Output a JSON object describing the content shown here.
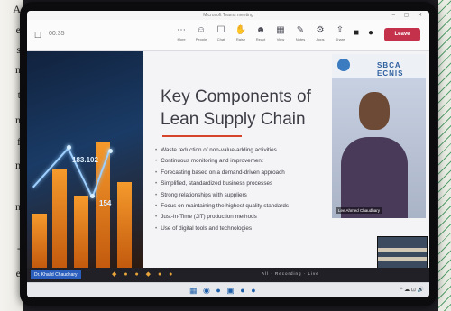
{
  "left_page": {
    "letters": [
      "A",
      "e",
      "s",
      "n",
      "t",
      "n",
      "f",
      "n",
      "n",
      "-",
      "e"
    ]
  },
  "window": {
    "title": "Microsoft Teams meeting",
    "controls": "– ▢ ✕"
  },
  "toolbar": {
    "time": "00:35",
    "items": [
      {
        "icon": "⋯",
        "label": "More"
      },
      {
        "icon": "☺",
        "label": "People"
      },
      {
        "icon": "☐",
        "label": "Chat"
      },
      {
        "icon": "✋",
        "label": "Raise"
      },
      {
        "icon": "☻",
        "label": "React"
      },
      {
        "icon": "▦",
        "label": "View"
      },
      {
        "icon": "✎",
        "label": "Notes"
      },
      {
        "icon": "⚙",
        "label": "Apps"
      },
      {
        "icon": "⇪",
        "label": "Share"
      }
    ],
    "camera_icon": "■",
    "mic_icon": "●",
    "share_icon": "▲",
    "leave_label": "Leave"
  },
  "slide": {
    "title_line1": "Key Components of",
    "title_line2": "Lean Supply Chain",
    "bullets": [
      "Waste reduction of non-value-adding activities",
      "Continuous monitoring and improvement",
      "Forecasting based on a demand-driven approach",
      "Simplified, standardized business processes",
      "Strong relationships with suppliers",
      "Focus on maintaining the highest quality standards",
      "Just-In-Time (JIT) production methods",
      "Use of digital tools and technologies"
    ],
    "art_labels": [
      "183.102",
      "154"
    ]
  },
  "webcam": {
    "brand": "SBCA  ECNIS",
    "name": "Lee Ahmed Chaudhary"
  },
  "bottom_strip": {
    "presenter": "Dr. Khalid Chaudhary",
    "icons": "◆ ● ● ◆ ● ●",
    "status": "All  ·  Recording  ·  Live"
  },
  "taskbar": {
    "icons": "▦ ◉ ● ▣ ● ●",
    "tray": "^ ☁ ⊡ 🔊"
  },
  "colors": {
    "accent": "#c4314b",
    "slide_rule": "#d5452c",
    "presenter_tag": "#2c5fbd"
  }
}
